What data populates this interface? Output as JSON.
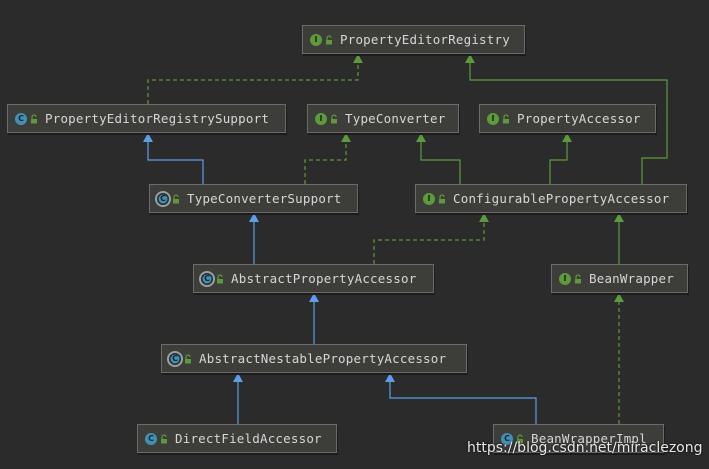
{
  "diagram": {
    "colors": {
      "background": "#2b2b2b",
      "node_fill": "#3d3e3a",
      "node_border": "#6b6b6b",
      "implements_edge": "#5d9a3a",
      "extends_edge": "#5aa0e8",
      "interface_icon": "#5d9a3a",
      "class_icon": "#3d92b8"
    },
    "nodes": [
      {
        "id": "PropertyEditorRegistry",
        "label": "PropertyEditorRegistry",
        "kind": "interface",
        "icon": "interface-icon"
      },
      {
        "id": "PropertyEditorRegistrySupport",
        "label": "PropertyEditorRegistrySupport",
        "kind": "class",
        "icon": "class-icon"
      },
      {
        "id": "TypeConverter",
        "label": "TypeConverter",
        "kind": "interface",
        "icon": "interface-icon"
      },
      {
        "id": "PropertyAccessor",
        "label": "PropertyAccessor",
        "kind": "interface",
        "icon": "interface-icon"
      },
      {
        "id": "TypeConverterSupport",
        "label": "TypeConverterSupport",
        "kind": "abstract-class",
        "icon": "abstract-class-icon"
      },
      {
        "id": "ConfigurablePropertyAccessor",
        "label": "ConfigurablePropertyAccessor",
        "kind": "interface",
        "icon": "interface-icon"
      },
      {
        "id": "AbstractPropertyAccessor",
        "label": "AbstractPropertyAccessor",
        "kind": "abstract-class",
        "icon": "abstract-class-icon"
      },
      {
        "id": "BeanWrapper",
        "label": "BeanWrapper",
        "kind": "interface",
        "icon": "interface-icon"
      },
      {
        "id": "AbstractNestablePropertyAccessor",
        "label": "AbstractNestablePropertyAccessor",
        "kind": "abstract-class",
        "icon": "abstract-class-icon"
      },
      {
        "id": "DirectFieldAccessor",
        "label": "DirectFieldAccessor",
        "kind": "class",
        "icon": "class-icon"
      },
      {
        "id": "BeanWrapperImpl",
        "label": "BeanWrapperImpl",
        "kind": "class",
        "icon": "class-icon"
      }
    ],
    "edges": [
      {
        "from": "PropertyEditorRegistrySupport",
        "to": "PropertyEditorRegistry",
        "type": "implements"
      },
      {
        "from": "TypeConverterSupport",
        "to": "PropertyEditorRegistrySupport",
        "type": "extends"
      },
      {
        "from": "TypeConverterSupport",
        "to": "TypeConverter",
        "type": "implements"
      },
      {
        "from": "ConfigurablePropertyAccessor",
        "to": "TypeConverter",
        "type": "extends-interface"
      },
      {
        "from": "ConfigurablePropertyAccessor",
        "to": "PropertyAccessor",
        "type": "extends-interface"
      },
      {
        "from": "ConfigurablePropertyAccessor",
        "to": "PropertyEditorRegistry",
        "type": "extends-interface"
      },
      {
        "from": "AbstractPropertyAccessor",
        "to": "TypeConverterSupport",
        "type": "extends"
      },
      {
        "from": "AbstractPropertyAccessor",
        "to": "ConfigurablePropertyAccessor",
        "type": "implements"
      },
      {
        "from": "BeanWrapper",
        "to": "ConfigurablePropertyAccessor",
        "type": "extends-interface"
      },
      {
        "from": "AbstractNestablePropertyAccessor",
        "to": "AbstractPropertyAccessor",
        "type": "extends"
      },
      {
        "from": "DirectFieldAccessor",
        "to": "AbstractNestablePropertyAccessor",
        "type": "extends"
      },
      {
        "from": "BeanWrapperImpl",
        "to": "AbstractNestablePropertyAccessor",
        "type": "extends"
      },
      {
        "from": "BeanWrapperImpl",
        "to": "BeanWrapper",
        "type": "implements"
      }
    ]
  },
  "watermark": "https://blog.csdn.net/miraclezong"
}
